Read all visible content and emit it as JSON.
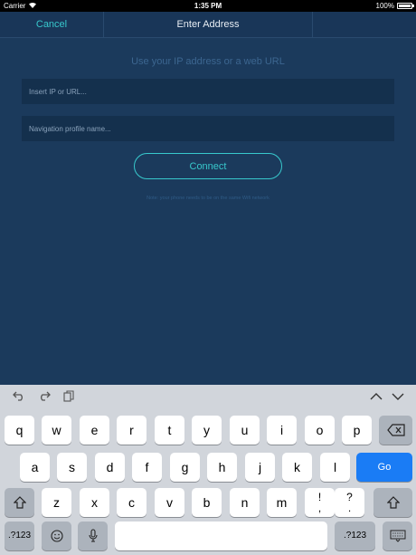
{
  "status_bar": {
    "carrier": "Carrier",
    "time": "1:35 PM",
    "battery": "100%"
  },
  "nav": {
    "cancel": "Cancel",
    "title": "Enter Address"
  },
  "main": {
    "subtitle": "Use your IP address or a web URL",
    "ip_placeholder": "Insert IP or URL...",
    "profile_placeholder": "Navigation profile name...",
    "connect": "Connect",
    "note": "Note: your phone needs to be on the same Wifi network"
  },
  "keyboard": {
    "row1": [
      "q",
      "w",
      "e",
      "r",
      "t",
      "y",
      "u",
      "i",
      "o",
      "p"
    ],
    "row2": [
      "a",
      "s",
      "d",
      "f",
      "g",
      "h",
      "j",
      "k",
      "l"
    ],
    "row3": [
      "z",
      "x",
      "c",
      "v",
      "b",
      "n",
      "m"
    ],
    "go": "Go",
    "numbers": ".?123",
    "punct1": {
      "top": "!",
      "bottom": ","
    },
    "punct2": {
      "top": "?",
      "bottom": "."
    },
    "icons": {
      "undo": "undo-icon",
      "redo": "redo-icon",
      "paste": "paste-icon",
      "up": "chevron-up-icon",
      "down": "chevron-down-icon",
      "backspace": "backspace-icon",
      "shift": "shift-icon",
      "emoji": "emoji-icon",
      "mic": "microphone-icon",
      "dismiss": "keyboard-dismiss-icon"
    }
  },
  "colors": {
    "background": "#1b3a5c",
    "accent": "#38c8cc",
    "go": "#1a7cf5"
  }
}
